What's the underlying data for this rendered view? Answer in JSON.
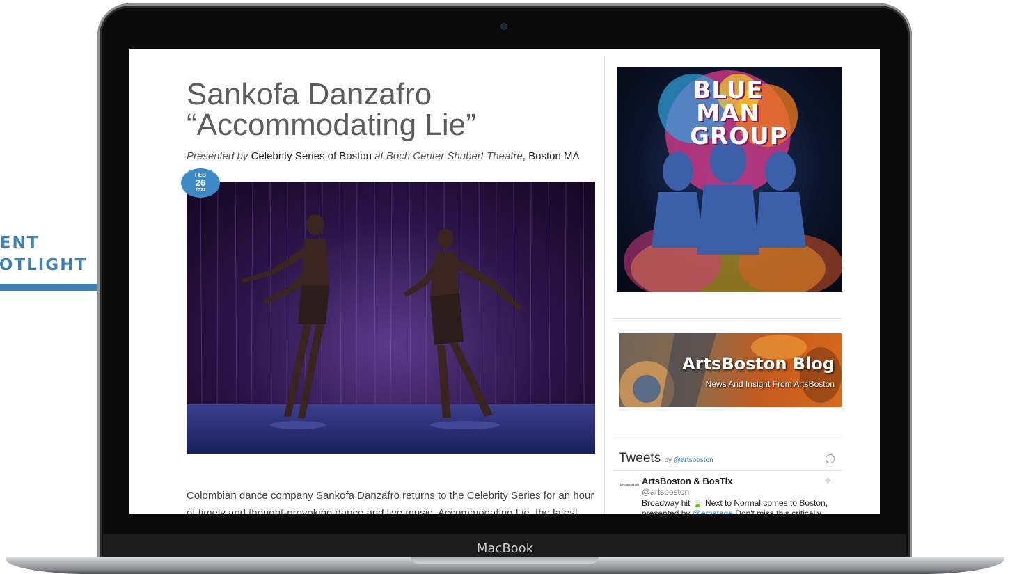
{
  "spotlight": {
    "line1": "VENT",
    "line2": "POTLIGHT"
  },
  "laptop": {
    "brand": "MacBook"
  },
  "event": {
    "title": "Sankofa Danzafro “Accommodating Lie”",
    "presented_by_label": "Presented by",
    "presenter": "Celebrity Series of Boston",
    "at_label": "at",
    "venue": "Boch Center Shubert Theatre",
    "city": ", Boston MA",
    "date": {
      "month": "FEB",
      "day": "26",
      "year": "2022"
    },
    "body": "Colombian dance company Sankofa Danzafro returns to the Celebrity Series for an hour of timely and thought-provoking dance and live music. Accommodating Lie, the latest work"
  },
  "sidebar": {
    "ad": {
      "logo": "BLUE MAN GROUP"
    },
    "blog": {
      "title": "ArtsBoston Blog",
      "subtitle": "News And Insight From ArtsBoston"
    },
    "tweets": {
      "heading": "Tweets",
      "by_label": "by",
      "handle_link": "@artsboston",
      "info_icon": "i",
      "avatar_text": "ARTSBOSTON",
      "author": "ArtsBoston & BosTix",
      "handle": "@artsboston",
      "text_before": "Broadway hit 🍃 Next to Normal comes to Boston, presented by ",
      "mention": "@emstage",
      "text_after": " Don't miss this critically"
    }
  },
  "colors": {
    "accent": "#3f82b6",
    "badge": "#3d8ac9",
    "link": "#2b7bb9"
  }
}
